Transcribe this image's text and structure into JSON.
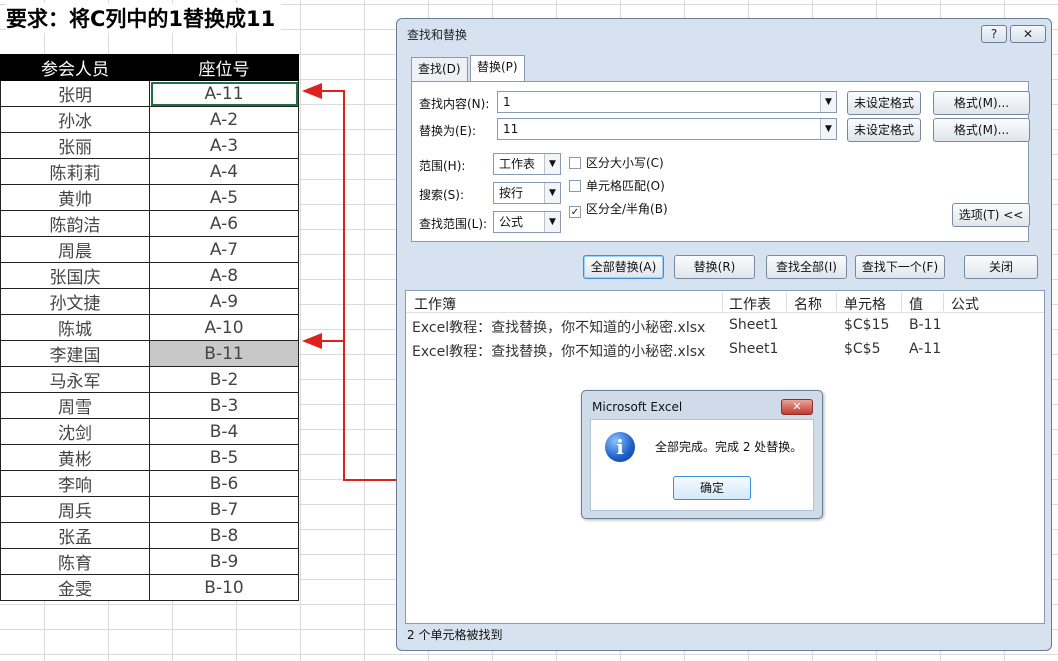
{
  "title": "要求：将C列中的1替换成11",
  "sheet": {
    "headers": [
      "参会人员",
      "座位号"
    ],
    "rows": [
      [
        "张明",
        "A-11"
      ],
      [
        "孙冰",
        "A-2"
      ],
      [
        "张丽",
        "A-3"
      ],
      [
        "陈莉莉",
        "A-4"
      ],
      [
        "黄帅",
        "A-5"
      ],
      [
        "陈韵洁",
        "A-6"
      ],
      [
        "周晨",
        "A-7"
      ],
      [
        "张国庆",
        "A-8"
      ],
      [
        "孙文捷",
        "A-9"
      ],
      [
        "陈城",
        "A-10"
      ],
      [
        "李建国",
        "B-11"
      ],
      [
        "马永军",
        "B-2"
      ],
      [
        "周雪",
        "B-3"
      ],
      [
        "沈剑",
        "B-4"
      ],
      [
        "黄彬",
        "B-5"
      ],
      [
        "李响",
        "B-6"
      ],
      [
        "周兵",
        "B-7"
      ],
      [
        "张孟",
        "B-8"
      ],
      [
        "陈育",
        "B-9"
      ],
      [
        "金雯",
        "B-10"
      ]
    ]
  },
  "dialog": {
    "title": "查找和替换",
    "help_label": "?",
    "close_label": "✕",
    "tab_find": "查找(D)",
    "tab_replace": "替换(P)",
    "find_label": "查找内容(N):",
    "find_value": "1",
    "replace_label": "替换为(E):",
    "replace_value": "11",
    "format_not_set": "未设定格式",
    "format_btn": "格式(M)...",
    "range_label": "范围(H):",
    "range_value": "工作表",
    "search_label": "搜索(S):",
    "search_value": "按行",
    "lookin_label": "查找范围(L):",
    "lookin_value": "公式",
    "match_case": "区分大小写(C)",
    "match_cell": "单元格匹配(O)",
    "match_width": "区分全/半角(B)",
    "options_btn": "选项(T) <<",
    "replace_all": "全部替换(A)",
    "replace": "替换(R)",
    "find_all": "查找全部(I)",
    "find_next": "查找下一个(F)",
    "close": "关闭",
    "columns": [
      "工作簿",
      "工作表",
      "名称",
      "单元格",
      "值",
      "公式"
    ],
    "results": [
      {
        "book": "Excel教程：查找替换，你不知道的小秘密.xlsx",
        "sheet": "Sheet1",
        "cell": "$C$15",
        "value": "B-11"
      },
      {
        "book": "Excel教程：查找替换，你不知道的小秘密.xlsx",
        "sheet": "Sheet1",
        "cell": "$C$5",
        "value": "A-11"
      }
    ],
    "status": "2 个单元格被找到"
  },
  "msgbox": {
    "title": "Microsoft Excel",
    "close_label": "✕",
    "icon": "info-icon",
    "text": "全部完成。完成 2 处替换。",
    "ok": "确定"
  },
  "colors": {
    "arrow": "#e02020",
    "selection": "#1e7145",
    "highlight": "#c8c8c8"
  }
}
